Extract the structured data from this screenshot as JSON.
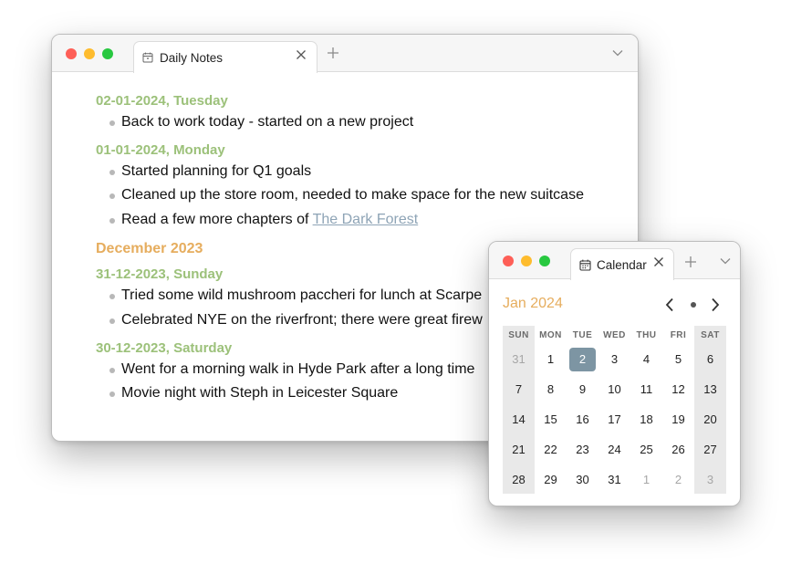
{
  "notes_window": {
    "tab": {
      "icon": "calendar-icon",
      "label": "Daily Notes"
    },
    "add_tab": "+",
    "entries": [
      {
        "kind": "day",
        "heading": "02-01-2024, Tuesday",
        "items": [
          {
            "text": "Back to work today - started on a new project"
          }
        ]
      },
      {
        "kind": "day",
        "heading": "01-01-2024, Monday",
        "items": [
          {
            "text": "Started planning for Q1 goals"
          },
          {
            "text": "Cleaned up the store room, needed to make space for the new suitcase"
          },
          {
            "text": "Read a few more chapters of ",
            "link": "The Dark Forest"
          }
        ]
      },
      {
        "kind": "month",
        "heading": "December 2023"
      },
      {
        "kind": "day",
        "heading": "31-12-2023, Sunday",
        "items": [
          {
            "text": "Tried some wild mushroom paccheri for lunch at Scarpe"
          },
          {
            "text": "Celebrated NYE on the riverfront; there were great firew"
          }
        ]
      },
      {
        "kind": "day",
        "heading": "30-12-2023, Saturday",
        "items": [
          {
            "text": "Went for a morning walk in Hyde Park after a long time"
          },
          {
            "text": "Movie night with Steph in Leicester Square"
          }
        ]
      }
    ]
  },
  "calendar_window": {
    "tab": {
      "icon": "calendar-icon",
      "label": "Calendar"
    },
    "add_tab": "+",
    "month_label": "Jan 2024",
    "weekdays": [
      "SUN",
      "MON",
      "TUE",
      "WED",
      "THU",
      "FRI",
      "SAT"
    ],
    "weeks": [
      [
        {
          "d": "31",
          "muted": true
        },
        {
          "d": "1"
        },
        {
          "d": "2",
          "today": true
        },
        {
          "d": "3"
        },
        {
          "d": "4"
        },
        {
          "d": "5"
        },
        {
          "d": "6"
        }
      ],
      [
        {
          "d": "7"
        },
        {
          "d": "8"
        },
        {
          "d": "9"
        },
        {
          "d": "10"
        },
        {
          "d": "11"
        },
        {
          "d": "12"
        },
        {
          "d": "13"
        }
      ],
      [
        {
          "d": "14"
        },
        {
          "d": "15"
        },
        {
          "d": "16"
        },
        {
          "d": "17"
        },
        {
          "d": "18"
        },
        {
          "d": "19"
        },
        {
          "d": "20"
        }
      ],
      [
        {
          "d": "21"
        },
        {
          "d": "22"
        },
        {
          "d": "23"
        },
        {
          "d": "24"
        },
        {
          "d": "25"
        },
        {
          "d": "26"
        },
        {
          "d": "27"
        }
      ],
      [
        {
          "d": "28"
        },
        {
          "d": "29"
        },
        {
          "d": "30"
        },
        {
          "d": "31"
        },
        {
          "d": "1",
          "muted": true
        },
        {
          "d": "2",
          "muted": true
        },
        {
          "d": "3",
          "muted": true
        }
      ]
    ]
  },
  "colors": {
    "day_heading": "#9cc17a",
    "month_heading": "#e6ad5e",
    "link": "#8ea4b6",
    "today_highlight": "#7d95a3",
    "traffic_close": "#fe5f57",
    "traffic_minimize": "#febc2e",
    "traffic_zoom": "#28c840"
  }
}
